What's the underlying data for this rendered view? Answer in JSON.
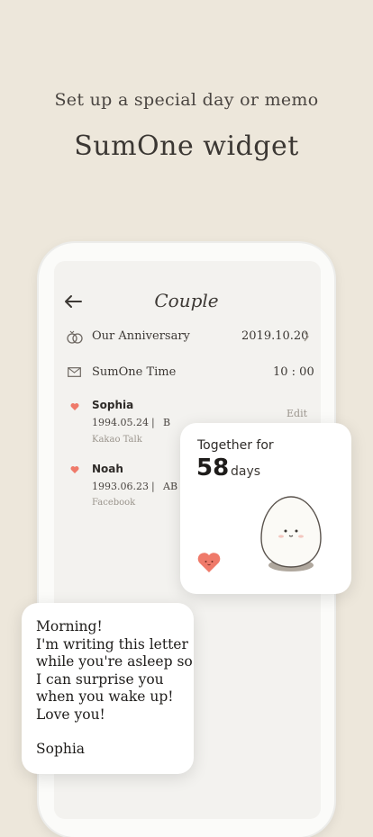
{
  "header": {
    "subtitle": "Set up a special day or memo",
    "title": "SumOne widget"
  },
  "couple_screen": {
    "title": "Couple",
    "anniversary": {
      "label": "Our Anniversary",
      "value": "2019.10.20"
    },
    "sumone_time": {
      "label": "SumOne Time",
      "value": "10 : 00"
    },
    "edit_label": "Edit",
    "people": [
      {
        "name": "Sophia",
        "birth": "1994.05.24",
        "sep": "|",
        "blood": "B",
        "source": "Kakao Talk"
      },
      {
        "name": "Noah",
        "birth": "1993.06.23",
        "sep": "|",
        "blood": "AB",
        "source": "Facebook"
      }
    ]
  },
  "widget": {
    "label": "Together for",
    "days": "58",
    "unit": "days"
  },
  "letter": {
    "lines": [
      "Morning!",
      "I'm writing this letter",
      "while you're asleep so",
      "I can surprise you",
      "when you wake up!",
      "Love you!"
    ],
    "signature": "Sophia"
  },
  "colors": {
    "background": "#ede7db",
    "heart": "#ef7a6a",
    "text": "#3c3834"
  }
}
